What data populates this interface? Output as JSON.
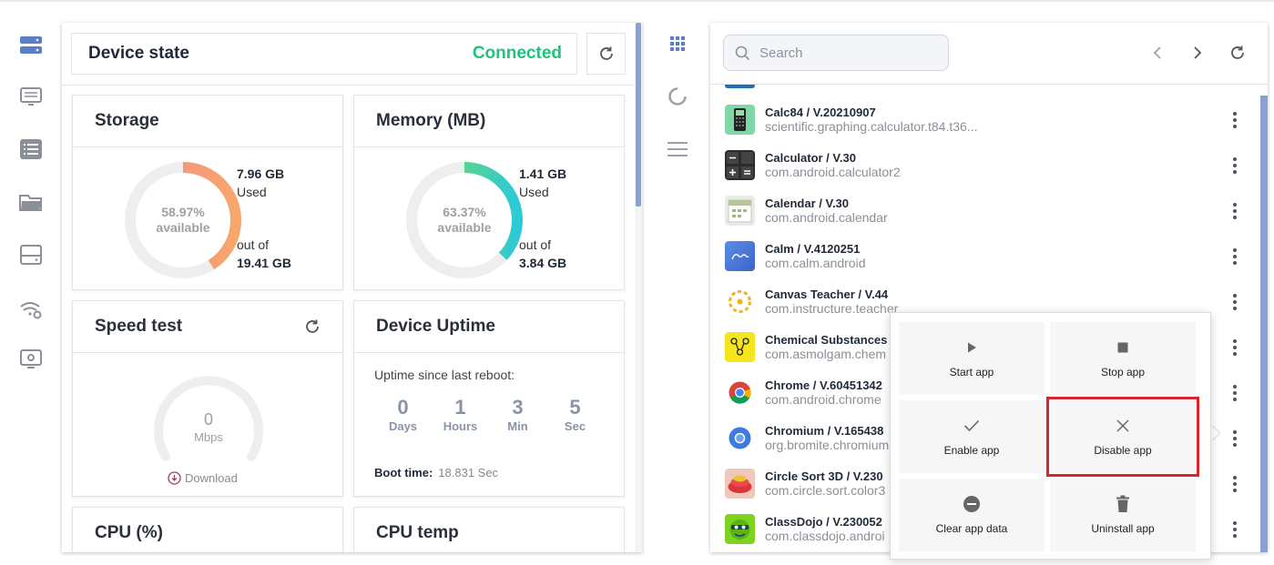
{
  "device": {
    "title": "Device state",
    "status": "Connected",
    "status_color": "#22c27a"
  },
  "storage": {
    "title": "Storage",
    "percent": "58.97%",
    "available_label": "available",
    "used_value": "7.96 GB",
    "used_label": "Used",
    "outof_label": "out of",
    "total_value": "19.41 GB",
    "used_fraction": 0.41
  },
  "memory": {
    "title": "Memory (MB)",
    "percent": "63.37%",
    "available_label": "available",
    "used_value": "1.41 GB",
    "used_label": "Used",
    "outof_label": "out of",
    "total_value": "3.84 GB",
    "used_fraction": 0.37
  },
  "speed": {
    "title": "Speed test",
    "value": "0",
    "unit": "Mbps",
    "download_label": "Download"
  },
  "uptime": {
    "title": "Device Uptime",
    "label": "Uptime since last reboot:",
    "cells": [
      {
        "num": "0",
        "unit": "Days"
      },
      {
        "num": "1",
        "unit": "Hours"
      },
      {
        "num": "3",
        "unit": "Min"
      },
      {
        "num": "5",
        "unit": "Sec"
      }
    ],
    "boot_label": "Boot time:",
    "boot_value": "18.831 Sec"
  },
  "cpu": {
    "title": "CPU (%)"
  },
  "cputemp": {
    "title": "CPU temp"
  },
  "apps_panel": {
    "search_placeholder": "Search"
  },
  "apps": [
    {
      "name": "Calc84 / V.20210907",
      "pkg": "scientific.graphing.calculator.t84.t36..."
    },
    {
      "name": "Calculator / V.30",
      "pkg": "com.android.calculator2"
    },
    {
      "name": "Calendar / V.30",
      "pkg": "com.android.calendar"
    },
    {
      "name": "Calm / V.4120251",
      "pkg": "com.calm.android"
    },
    {
      "name": "Canvas Teacher / V.44",
      "pkg": "com.instructure.teacher"
    },
    {
      "name": "Chemical Substances",
      "pkg": "com.asmolgam.chem"
    },
    {
      "name": "Chrome / V.60451342",
      "pkg": "com.android.chrome"
    },
    {
      "name": "Chromium / V.165438",
      "pkg": "org.bromite.chromium"
    },
    {
      "name": "Circle Sort 3D / V.230",
      "pkg": "com.circle.sort.color3"
    },
    {
      "name": "ClassDojo / V.230052",
      "pkg": "com.classdojo.androi"
    }
  ],
  "menu": {
    "start": "Start app",
    "stop": "Stop app",
    "enable": "Enable app",
    "disable": "Disable app",
    "clear": "Clear app data",
    "uninstall": "Uninstall app",
    "highlight_color": "#d9232e"
  }
}
